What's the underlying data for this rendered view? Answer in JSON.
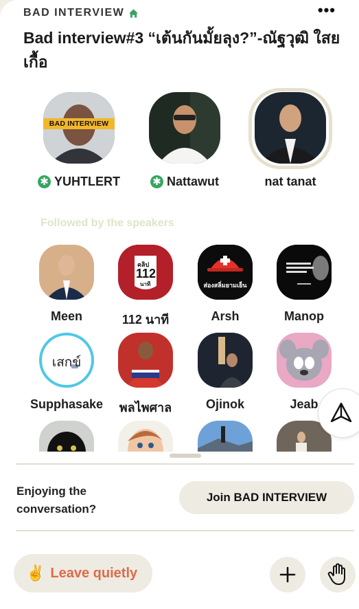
{
  "room": {
    "club_name": "BAD INTERVIEW",
    "title": "Bad interview#3 “เต้นกันมั้ยลุง?”-ณัฐวุฒิ ใสยเกื้อ"
  },
  "speakers": [
    {
      "name": "YUHTLERT",
      "moderator": true,
      "banner": "BAD INTERVIEW"
    },
    {
      "name": "Nattawut",
      "moderator": true
    },
    {
      "name": "nat tanat",
      "moderator": false
    }
  ],
  "followed_heading": "Followed by the speakers",
  "audience": [
    {
      "name": "Meen"
    },
    {
      "name": "112 นาที",
      "logo_top": "คลิป",
      "logo_num": "112",
      "logo_bottom": "นาที"
    },
    {
      "name": "Arsh",
      "logo_text": "ส่องสลิ่มยามเย็น"
    },
    {
      "name": "Manop"
    },
    {
      "name": "Supphasake",
      "avatar_text": "เสกข์"
    },
    {
      "name": "พลไพศาล"
    },
    {
      "name": "Ojinok"
    },
    {
      "name": "Jeab"
    }
  ],
  "cta": {
    "prompt": "Enjoying the conversation?",
    "join_label": "Join BAD INTERVIEW"
  },
  "bottom_bar": {
    "leave_label": "Leave quietly",
    "leave_emoji": "✌️"
  },
  "icons": {
    "home": "home-icon",
    "more": "more-icon",
    "ping": "ping-icon",
    "add": "plus-icon",
    "raise_hand": "raise-hand-icon"
  },
  "colors": {
    "background": "#f1efe4",
    "moderator_badge": "#37a561",
    "leave_text": "#de6a4a",
    "button_bg": "#eeebe2"
  }
}
